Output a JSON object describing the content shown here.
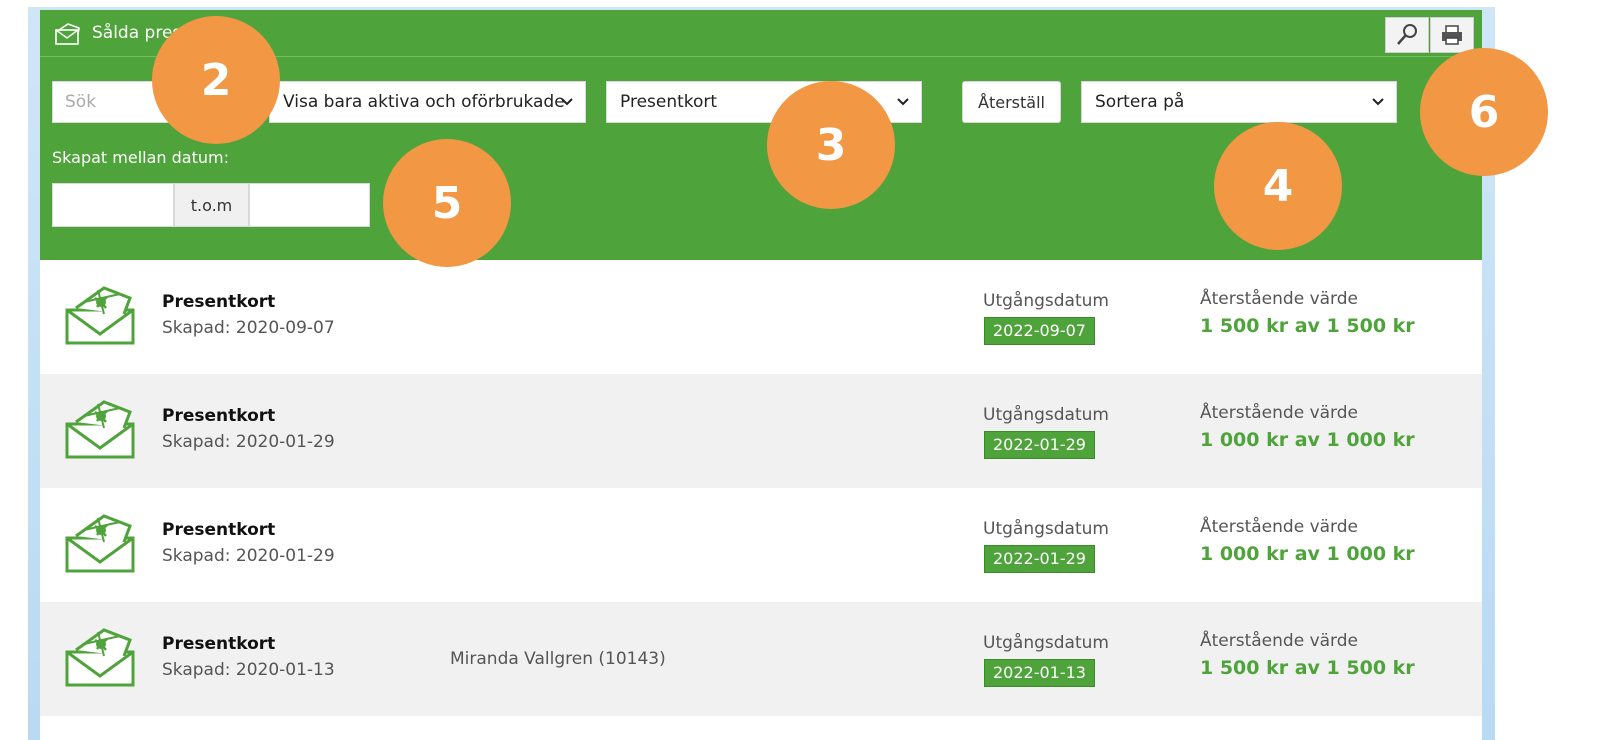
{
  "header": {
    "title": "Sålda pres",
    "search_placeholder": "Sök",
    "filter_select": "Visa bara aktiva och oförbrukade",
    "type_select": "Presentkort",
    "reset_label": "Återställ",
    "sort_select": "Sortera på",
    "date_label": "Skapat mellan datum:",
    "date_separator": "t.o.m",
    "tool_icons": [
      "search-icon",
      "print-icon"
    ]
  },
  "list": {
    "expiry_label": "Utgångsdatum",
    "remaining_label": "Återstående värde",
    "rows": [
      {
        "title": "Presentkort",
        "created": "Skapad: 2020-09-07",
        "customer": "",
        "expiry": "2022-09-07",
        "remaining": "1 500 kr av 1 500 kr"
      },
      {
        "title": "Presentkort",
        "created": "Skapad: 2020-01-29",
        "customer": "",
        "expiry": "2022-01-29",
        "remaining": "1 000 kr av 1 000 kr"
      },
      {
        "title": "Presentkort",
        "created": "Skapad: 2020-01-29",
        "customer": "",
        "expiry": "2022-01-29",
        "remaining": "1 000 kr av 1 000 kr"
      },
      {
        "title": "Presentkort",
        "created": "Skapad: 2020-01-13",
        "customer": "Miranda Vallgren (10143)",
        "expiry": "2022-01-13",
        "remaining": "1 500 kr av 1 500 kr"
      }
    ]
  },
  "callouts": [
    "2",
    "3",
    "4",
    "5",
    "6"
  ],
  "colors": {
    "header_green": "#4fa33b",
    "callout_orange": "#f29744",
    "value_green": "#4fa33b"
  }
}
